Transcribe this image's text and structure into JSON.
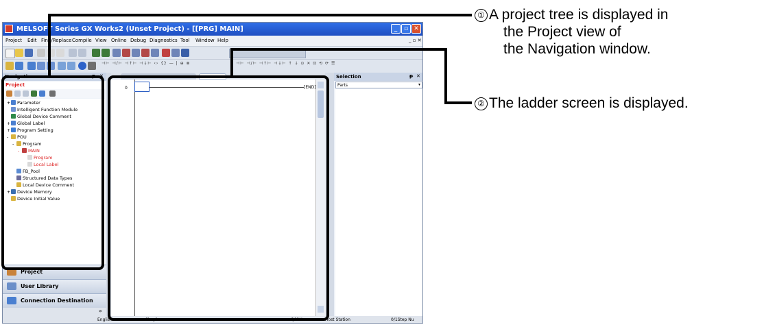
{
  "window": {
    "title": "MELSOFT Series GX Works2 (Unset Project) - [[PRG] MAIN]",
    "minimize": "_",
    "restore": "▫",
    "close": "✕"
  },
  "menu": [
    "Project",
    "Edit",
    "Find/Replace",
    "Compile",
    "View",
    "Online",
    "Debug",
    "Diagnostics",
    "Tool",
    "Window",
    "Help"
  ],
  "navigation": {
    "header": "Navigation",
    "project_label": "Project",
    "tree": [
      {
        "label": "Parameter",
        "indent": 0,
        "expander": "+",
        "red": false
      },
      {
        "label": "Intelligent Function Module",
        "indent": 0,
        "expander": "",
        "red": false
      },
      {
        "label": "Global Device Comment",
        "indent": 0,
        "expander": "",
        "red": false
      },
      {
        "label": "Global Label",
        "indent": 0,
        "expander": "+",
        "red": false
      },
      {
        "label": "Program Setting",
        "indent": 0,
        "expander": "+",
        "red": false
      },
      {
        "label": "POU",
        "indent": 0,
        "expander": "-",
        "red": false
      },
      {
        "label": "Program",
        "indent": 1,
        "expander": "-",
        "red": false
      },
      {
        "label": "MAIN",
        "indent": 2,
        "expander": "-",
        "red": true
      },
      {
        "label": "Program",
        "indent": 3,
        "expander": "",
        "red": true
      },
      {
        "label": "Local Label",
        "indent": 3,
        "expander": "",
        "red": true
      },
      {
        "label": "FB_Pool",
        "indent": 1,
        "expander": "",
        "red": false
      },
      {
        "label": "Structured Data Types",
        "indent": 1,
        "expander": "",
        "red": false
      },
      {
        "label": "Local Device Comment",
        "indent": 1,
        "expander": "",
        "red": false
      },
      {
        "label": "Device Memory",
        "indent": 0,
        "expander": "+",
        "red": false
      },
      {
        "label": "Device Initial Value",
        "indent": 0,
        "expander": "",
        "red": false
      }
    ],
    "tabs": [
      {
        "label": "Project",
        "color": "#c8823a"
      },
      {
        "label": "User Library",
        "color": "#6b8fc9"
      },
      {
        "label": "Connection Destination",
        "color": "#4a7fd0"
      }
    ],
    "more": "»"
  },
  "ladder": {
    "row_step": "0",
    "end_label": "END"
  },
  "selection": {
    "header": "Selection",
    "dropdown_value": "Parts"
  },
  "status": {
    "language": "English",
    "mode": "Simple",
    "cpu": "Q02U",
    "station": "Host Station",
    "steps": "0/1Step Nu"
  },
  "callouts": [
    {
      "number": "①",
      "lines": [
        "A project tree is displayed in",
        "the Project view of",
        "the Navigation window."
      ]
    },
    {
      "number": "②",
      "lines": [
        "The ladder screen is displayed."
      ]
    }
  ]
}
